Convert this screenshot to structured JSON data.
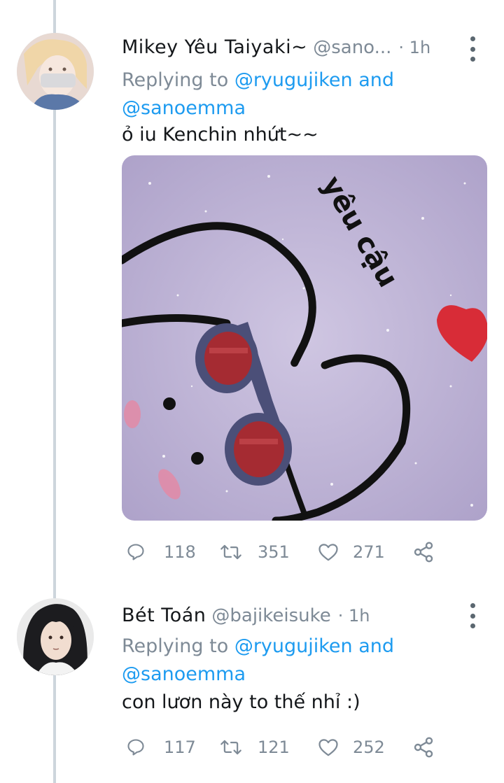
{
  "tweets": [
    {
      "display_name": "Mikey Yêu Taiyaki~",
      "handle": "@sano...",
      "time": "· 1h",
      "replying_prefix": "Replying to",
      "reply_to_1": "@ryugujiken",
      "reply_and": "and",
      "reply_to_2": "@sanoemma",
      "text": "ỏ iu Kenchin nhứt~~",
      "media": {
        "overlay_text": "yêu cậu"
      },
      "counts": {
        "replies": "118",
        "retweets": "351",
        "likes": "271"
      }
    },
    {
      "display_name": "Bét Toán",
      "handle": "@bajikeisuke",
      "time": "· 1h",
      "replying_prefix": "Replying to",
      "reply_to_1": "@ryugujiken",
      "reply_and": "and",
      "reply_to_2": "@sanoemma",
      "text": "con lươn này to thế nhỉ :)",
      "counts": {
        "replies": "117",
        "retweets": "121",
        "likes": "252"
      }
    }
  ],
  "colors": {
    "link": "#1d9bf0",
    "muted": "#7e8a96",
    "thread_line": "#cdd5dc"
  },
  "icons": [
    "reply-icon",
    "retweet-icon",
    "like-icon",
    "share-icon",
    "more-icon"
  ]
}
